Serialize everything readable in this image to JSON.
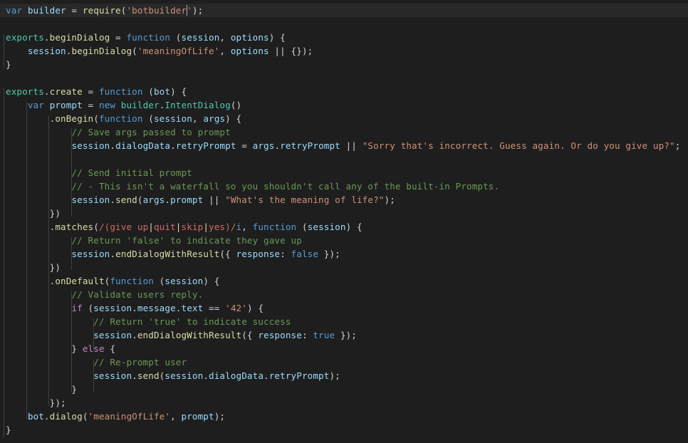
{
  "editor": {
    "name": "code-editor",
    "language": "JavaScript",
    "background_color": "#1e1e1e",
    "current_line_highlight_color": "#282828",
    "indent_guide_color": "#404040",
    "caret_color": "#aeafad",
    "font_size_px": 12.6,
    "line_height_px": 19,
    "total_lines": 32,
    "cursor_line": 1,
    "theme_colors": {
      "default_text": "#d4d4d4",
      "keyword": "#569cd6",
      "control_keyword": "#c586c0",
      "identifier": "#9cdcfe",
      "function_name": "#dcdcaa",
      "class_name": "#4ec9b0",
      "string": "#ce9178",
      "comment": "#6a9955",
      "regex": "#d16969",
      "number": "#b5cea8"
    }
  },
  "code": {
    "line_1": {
      "t1": "var",
      "t2": " ",
      "t3": "builder",
      "t4": " = ",
      "t5": "require",
      "t6": "(",
      "t7": "'botbuilder",
      "t8": "'",
      "t9": ");"
    },
    "line_3": {
      "t1": "exports",
      "t2": ".",
      "t3": "beginDialog",
      "t4": " = ",
      "t5": "function",
      "t6": " (",
      "t7": "session",
      "t8": ", ",
      "t9": "options",
      "t10": ") {"
    },
    "line_4": {
      "t1": "    ",
      "t2": "session",
      "t3": ".",
      "t4": "beginDialog",
      "t5": "(",
      "t6": "'meaningOfLife'",
      "t7": ", ",
      "t8": "options",
      "t9": " || {});"
    },
    "line_5": {
      "t1": "}"
    },
    "line_7": {
      "t1": "exports",
      "t2": ".",
      "t3": "create",
      "t4": " = ",
      "t5": "function",
      "t6": " (",
      "t7": "bot",
      "t8": ") {"
    },
    "line_8": {
      "t1": "    ",
      "t2": "var",
      "t3": " ",
      "t4": "prompt",
      "t5": " = ",
      "t6": "new",
      "t7": " ",
      "t8": "builder",
      "t9": ".",
      "t10": "IntentDialog",
      "t11": "()"
    },
    "line_9": {
      "t1": "        .",
      "t2": "onBegin",
      "t3": "(",
      "t4": "function",
      "t5": " (",
      "t6": "session",
      "t7": ", ",
      "t8": "args",
      "t9": ") {"
    },
    "line_10": {
      "t1": "            ",
      "t2": "// Save args passed to prompt"
    },
    "line_11": {
      "t1": "            ",
      "t2": "session",
      "t3": ".",
      "t4": "dialogData",
      "t5": ".",
      "t6": "retryPrompt",
      "t7": " = ",
      "t8": "args",
      "t9": ".",
      "t10": "retryPrompt",
      "t11": " || ",
      "t12": "\"Sorry that's incorrect. Guess again. Or do you give up?\"",
      "t13": ";"
    },
    "line_13": {
      "t1": "            ",
      "t2": "// Send initial prompt"
    },
    "line_14": {
      "t1": "            ",
      "t2": "// - This isn't a waterfall so you shouldn't call any of the built-in Prompts."
    },
    "line_15": {
      "t1": "            ",
      "t2": "session",
      "t3": ".",
      "t4": "send",
      "t5": "(",
      "t6": "args",
      "t7": ".",
      "t8": "prompt",
      "t9": " || ",
      "t10": "\"What's the meaning of life?\"",
      "t11": ");"
    },
    "line_16": {
      "t1": "        })"
    },
    "line_17": {
      "t1": "        .",
      "t2": "matches",
      "t3": "(",
      "t4": "/",
      "t5": "(give up",
      "t6": "|",
      "t7": "quit",
      "t8": "|",
      "t9": "skip",
      "t10": "|",
      "t11": "yes)",
      "t12": "/",
      "t13": "i",
      "t14": ", ",
      "t15": "function",
      "t16": " (",
      "t17": "session",
      "t18": ") {"
    },
    "line_18": {
      "t1": "            ",
      "t2": "// Return 'false' to indicate they gave up"
    },
    "line_19": {
      "t1": "            ",
      "t2": "session",
      "t3": ".",
      "t4": "endDialogWithResult",
      "t5": "({ ",
      "t6": "response",
      "t7": ": ",
      "t8": "false",
      "t9": " });"
    },
    "line_20": {
      "t1": "        })"
    },
    "line_21": {
      "t1": "        .",
      "t2": "onDefault",
      "t3": "(",
      "t4": "function",
      "t5": " (",
      "t6": "session",
      "t7": ") {"
    },
    "line_22": {
      "t1": "            ",
      "t2": "// Validate users reply."
    },
    "line_23": {
      "t1": "            ",
      "t2": "if",
      "t3": " (",
      "t4": "session",
      "t5": ".",
      "t6": "message",
      "t7": ".",
      "t8": "text",
      "t9": " == ",
      "t10": "'42'",
      "t11": ") {"
    },
    "line_24": {
      "t1": "                ",
      "t2": "// Return 'true' to indicate success"
    },
    "line_25": {
      "t1": "                ",
      "t2": "session",
      "t3": ".",
      "t4": "endDialogWithResult",
      "t5": "({ ",
      "t6": "response",
      "t7": ": ",
      "t8": "true",
      "t9": " });"
    },
    "line_26": {
      "t1": "            } ",
      "t2": "else",
      "t3": " {"
    },
    "line_27": {
      "t1": "                ",
      "t2": "// Re-prompt user"
    },
    "line_28": {
      "t1": "                ",
      "t2": "session",
      "t3": ".",
      "t4": "send",
      "t5": "(",
      "t6": "session",
      "t7": ".",
      "t8": "dialogData",
      "t9": ".",
      "t10": "retryPrompt",
      "t11": ");"
    },
    "line_29": {
      "t1": "            }"
    },
    "line_30": {
      "t1": "        });"
    },
    "line_31": {
      "t1": "    ",
      "t2": "bot",
      "t3": ".",
      "t4": "dialog",
      "t5": "(",
      "t6": "'meaningOfLife'",
      "t7": ", ",
      "t8": "prompt",
      "t9": ");"
    },
    "line_32": {
      "t1": "}"
    }
  }
}
